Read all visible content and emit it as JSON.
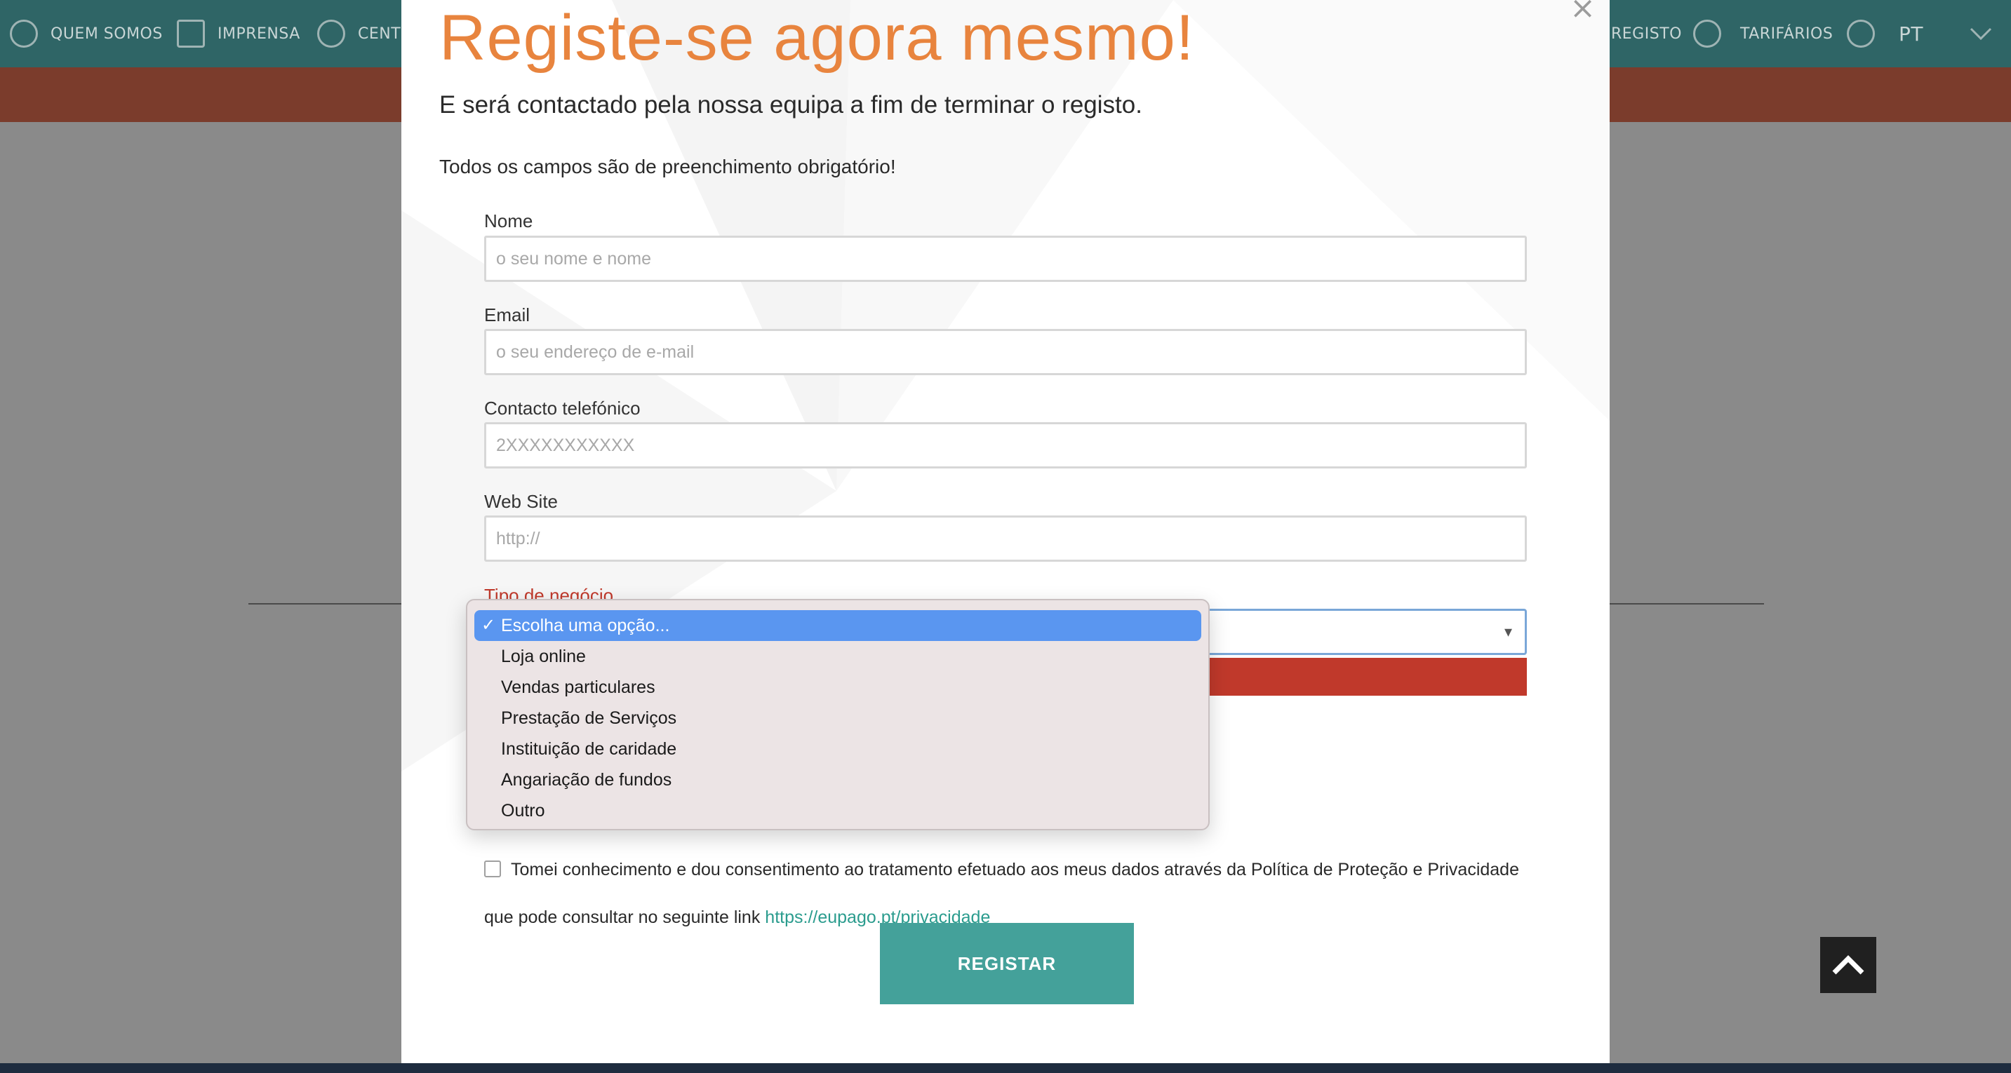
{
  "nav": {
    "items": [
      {
        "label": "QUEM SOMOS",
        "icon": "leaf-icon"
      },
      {
        "label": "IMPRENSA",
        "icon": "newspaper-icon"
      },
      {
        "label": "CENT",
        "icon": "headset-icon"
      },
      {
        "label": "REGISTO",
        "icon": "add-user-icon"
      },
      {
        "label": "TARIFÁRIOS",
        "icon": "euro-icon"
      }
    ],
    "language": "PT"
  },
  "modal": {
    "title": "Registe-se agora mesmo!",
    "subtitle": "E será contactado pela nossa equipa a fim de terminar o registo.",
    "required_note": "Todos os campos são de preenchimento obrigatório!",
    "close_symbol": "×",
    "fields": {
      "name": {
        "label": "Nome",
        "placeholder": "o seu nome e nome"
      },
      "email": {
        "label": "Email",
        "placeholder": "o seu endereço de e-mail"
      },
      "phone": {
        "label": "Contacto telefónico",
        "placeholder": "2XXXXXXXXXXX"
      },
      "website": {
        "label": "Web Site",
        "placeholder": "http://"
      },
      "business_type": {
        "label": "Tipo de negócio"
      }
    },
    "dropdown": {
      "selected": "Escolha uma opção...",
      "options": [
        "Escolha uma opção...",
        "Loja online",
        "Vendas particulares",
        "Prestação de Serviços",
        "Instituição de caridade",
        "Angariação de fundos",
        "Outro"
      ]
    },
    "consent": {
      "text": "Tomei conhecimento e dou consentimento ao tratamento efetuado aos meus dados através da Política de Proteção e Privacidade que pode consultar no seguinte link",
      "link": "https://eupago.pt/privacidade"
    },
    "submit_label": "REGISTAR"
  },
  "colors": {
    "title": "#e8843e",
    "teal": "#44a19a",
    "error": "#c0392b",
    "selected_option": "#5a96f0"
  }
}
